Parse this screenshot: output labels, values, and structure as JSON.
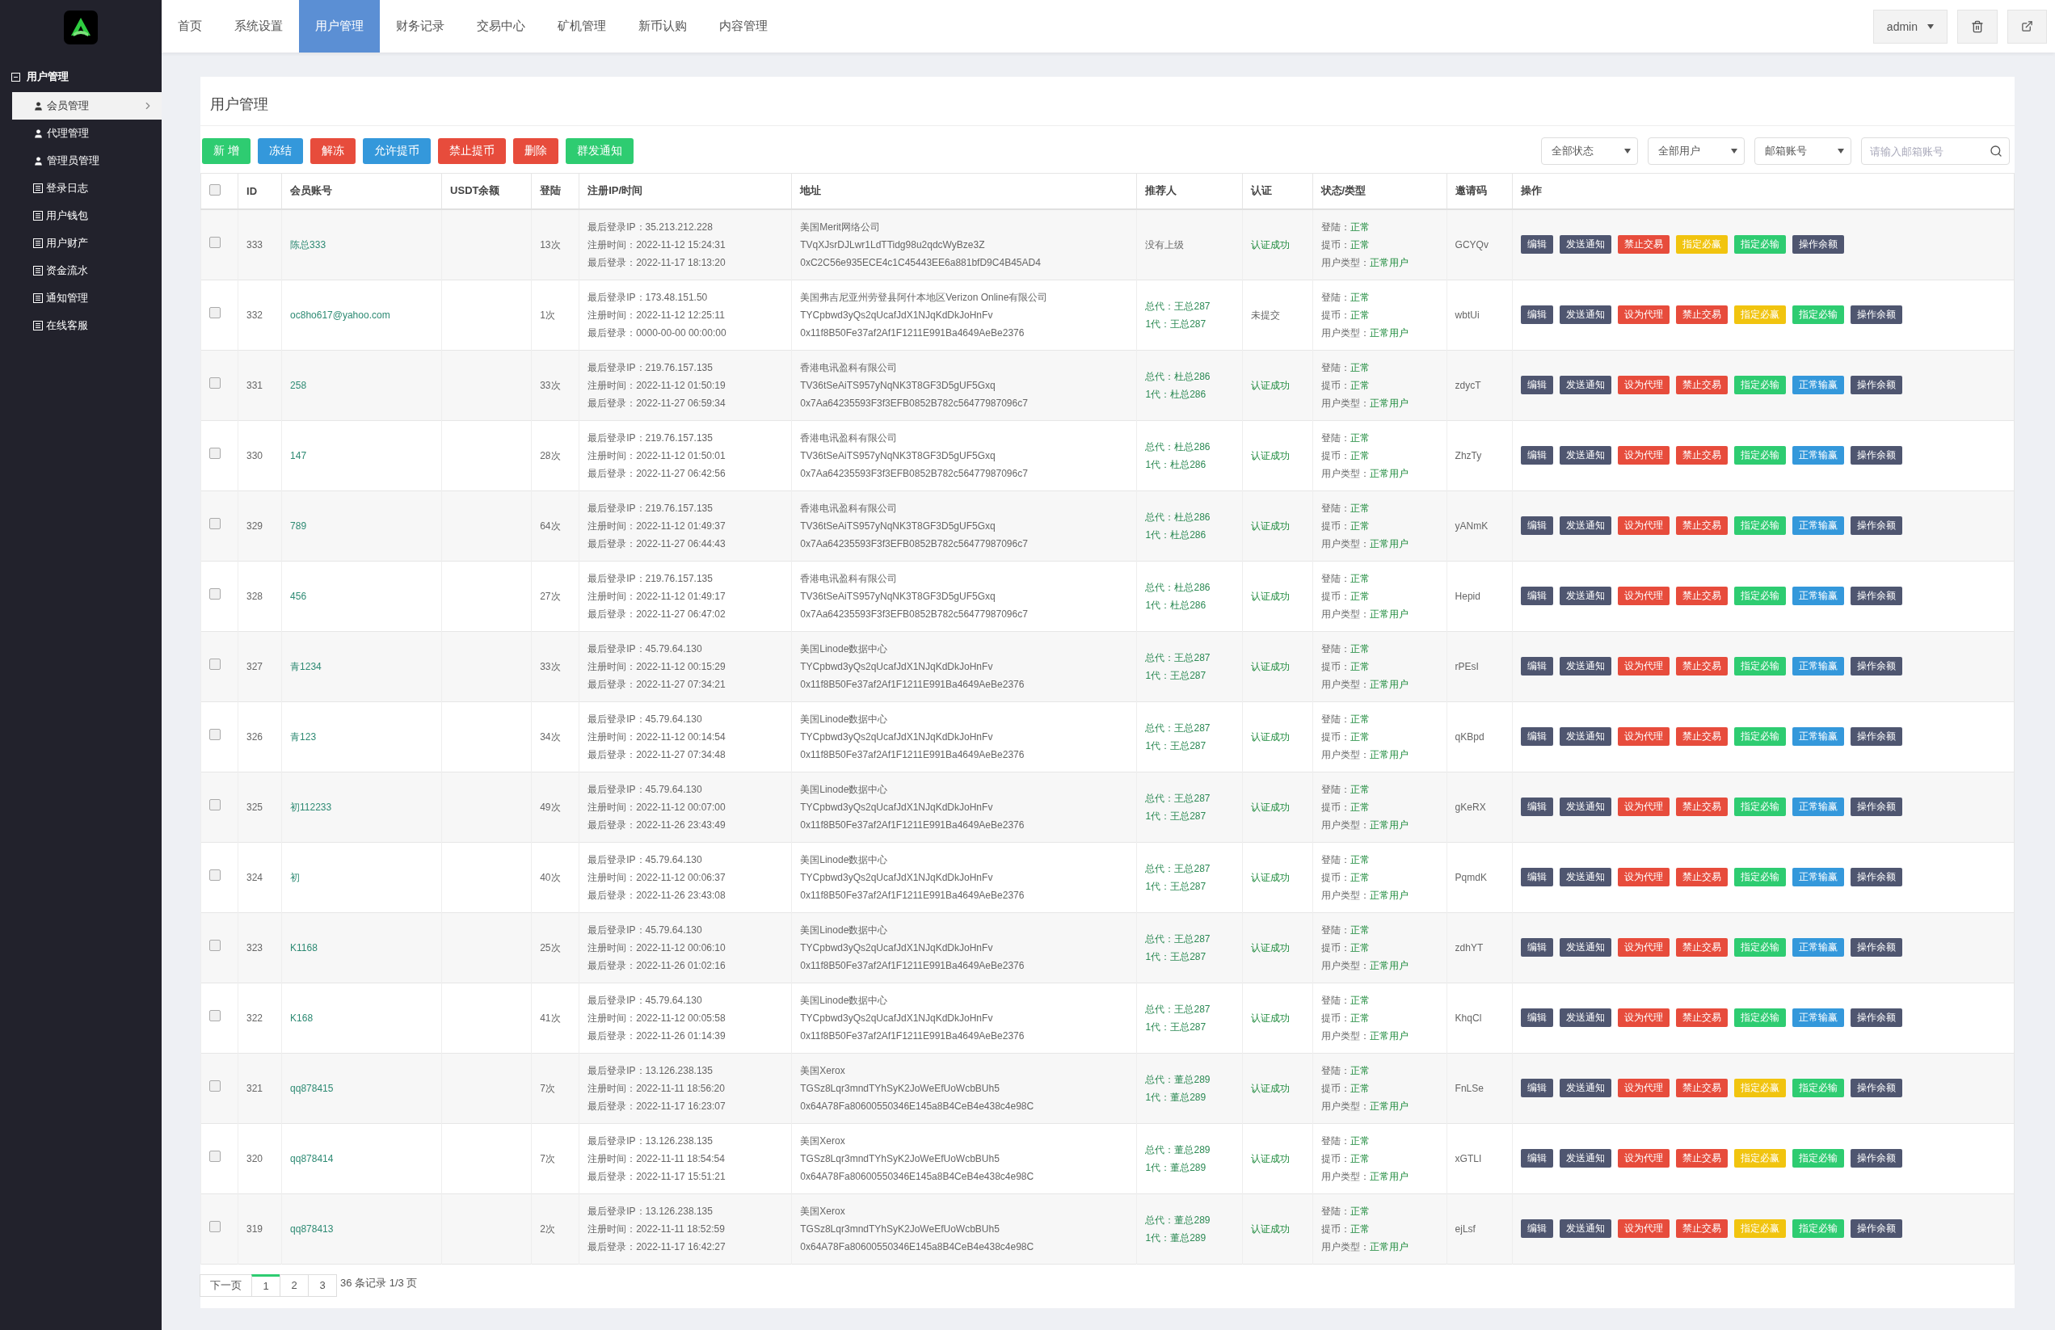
{
  "sidebar": {
    "section": "用户管理",
    "items": [
      {
        "label": "会员管理",
        "kind": "user",
        "selected": true
      },
      {
        "label": "代理管理",
        "kind": "user",
        "selected": false
      },
      {
        "label": "管理员管理",
        "kind": "user",
        "selected": false
      },
      {
        "label": "登录日志",
        "kind": "list",
        "selected": false
      },
      {
        "label": "用户钱包",
        "kind": "list",
        "selected": false
      },
      {
        "label": "用户财产",
        "kind": "list",
        "selected": false
      },
      {
        "label": "资金流水",
        "kind": "list",
        "selected": false
      },
      {
        "label": "通知管理",
        "kind": "list",
        "selected": false
      },
      {
        "label": "在线客服",
        "kind": "list",
        "selected": false
      }
    ]
  },
  "nav": {
    "tabs": [
      {
        "label": "首页",
        "selected": false
      },
      {
        "label": "系统设置",
        "selected": false
      },
      {
        "label": "用户管理",
        "selected": true
      },
      {
        "label": "财务记录",
        "selected": false
      },
      {
        "label": "交易中心",
        "selected": false
      },
      {
        "label": "矿机管理",
        "selected": false
      },
      {
        "label": "新币认购",
        "selected": false
      },
      {
        "label": "内容管理",
        "selected": false
      }
    ],
    "user": "admin"
  },
  "page_title": "用户管理",
  "toolbar": [
    {
      "label": "新 增",
      "kind": "green"
    },
    {
      "label": "冻结",
      "kind": "blue"
    },
    {
      "label": "解冻",
      "kind": "red"
    },
    {
      "label": "允许提币",
      "kind": "blue"
    },
    {
      "label": "禁止提币",
      "kind": "red"
    },
    {
      "label": "删除",
      "kind": "red"
    },
    {
      "label": "群发通知",
      "kind": "green"
    }
  ],
  "filters": {
    "selects": [
      "全部状态",
      "全部用户",
      "邮箱账号"
    ],
    "search_placeholder": "请输入邮箱账号"
  },
  "table": {
    "header_checked": false,
    "columns": [
      "ID",
      "会员账号",
      "USDT余额",
      "登陆",
      "注册IP/时间",
      "地址",
      "推荐人",
      "认证",
      "状态/类型",
      "邀请码",
      "操作"
    ],
    "rows": [
      {
        "checked": false,
        "id": "333",
        "account": "陈总333",
        "logins": "13次",
        "ip_time": [
          "最后登录IP：35.213.212.228",
          "注册时间：2022-11-12 15:24:31",
          "最后登录：2022-11-17 18:13:20"
        ],
        "address": [
          "美国Merit网络公司",
          "TVqXJsrDJLwr1LdTTidg98u2qdcWyBze3Z",
          "0xC2C56e935ECE4c1C45443EE6a881bfD9C4B45AD4"
        ],
        "referrer": {
          "kind": "none",
          "lines": [
            "没有上级"
          ]
        },
        "auth": {
          "text": "认证成功",
          "verified": true
        },
        "status": [
          {
            "label": "登陆：",
            "value": "正常"
          },
          {
            "label": "提币：",
            "value": "正常"
          },
          {
            "label": "用户类型：",
            "value": "正常用户"
          }
        ],
        "invite": "GCYQv",
        "actions": [
          {
            "label": "编辑",
            "kind": "dark"
          },
          {
            "label": "发送通知",
            "kind": "dark"
          },
          {
            "label": "禁止交易",
            "kind": "red"
          },
          {
            "label": "指定必赢",
            "kind": "yellow"
          },
          {
            "label": "指定必输",
            "kind": "green"
          },
          {
            "label": "操作余额",
            "kind": "dark"
          }
        ]
      },
      {
        "checked": false,
        "id": "332",
        "account": "oc8ho617@yahoo.com",
        "logins": "1次",
        "ip_time": [
          "最后登录IP：173.48.151.50",
          "注册时间：2022-11-12 12:25:11",
          "最后登录：0000-00-00 00:00:00"
        ],
        "address": [
          "美国弗吉尼亚州劳登县阿什本地区Verizon Online有限公司",
          "TYCpbwd3yQs2qUcafJdX1NJqKdDkJoHnFv",
          "0x11f8B50Fe37af2Af1F1211E991Ba4649AeBe2376"
        ],
        "referrer": {
          "kind": "chain",
          "lines": [
            "总代：王总287",
            "1代：王总287"
          ]
        },
        "auth": {
          "text": "未提交",
          "verified": false
        },
        "status": [
          {
            "label": "登陆：",
            "value": "正常"
          },
          {
            "label": "提币：",
            "value": "正常"
          },
          {
            "label": "用户类型：",
            "value": "正常用户"
          }
        ],
        "invite": "wbtUi",
        "actions": [
          {
            "label": "编辑",
            "kind": "dark"
          },
          {
            "label": "发送通知",
            "kind": "dark"
          },
          {
            "label": "设为代理",
            "kind": "red"
          },
          {
            "label": "禁止交易",
            "kind": "red"
          },
          {
            "label": "指定必赢",
            "kind": "yellow"
          },
          {
            "label": "指定必输",
            "kind": "green"
          },
          {
            "label": "操作余额",
            "kind": "dark"
          }
        ]
      },
      {
        "checked": false,
        "id": "331",
        "account": "258",
        "logins": "33次",
        "ip_time": [
          "最后登录IP：219.76.157.135",
          "注册时间：2022-11-12 01:50:19",
          "最后登录：2022-11-27 06:59:34"
        ],
        "address": [
          "香港电讯盈科有限公司",
          "TV36tSeAiTS957yNqNK3T8GF3D5gUF5Gxq",
          "0x7Aa64235593F3f3EFB0852B782c56477987096c7"
        ],
        "referrer": {
          "kind": "chain",
          "lines": [
            "总代：杜总286",
            "1代：杜总286"
          ]
        },
        "auth": {
          "text": "认证成功",
          "verified": true
        },
        "status": [
          {
            "label": "登陆：",
            "value": "正常"
          },
          {
            "label": "提币：",
            "value": "正常"
          },
          {
            "label": "用户类型：",
            "value": "正常用户"
          }
        ],
        "invite": "zdycT",
        "actions": [
          {
            "label": "编辑",
            "kind": "dark"
          },
          {
            "label": "发送通知",
            "kind": "dark"
          },
          {
            "label": "设为代理",
            "kind": "red"
          },
          {
            "label": "禁止交易",
            "kind": "red"
          },
          {
            "label": "指定必输",
            "kind": "green"
          },
          {
            "label": "正常输赢",
            "kind": "blue"
          },
          {
            "label": "操作余额",
            "kind": "dark"
          }
        ]
      },
      {
        "checked": false,
        "id": "330",
        "account": "147",
        "logins": "28次",
        "ip_time": [
          "最后登录IP：219.76.157.135",
          "注册时间：2022-11-12 01:50:01",
          "最后登录：2022-11-27 06:42:56"
        ],
        "address": [
          "香港电讯盈科有限公司",
          "TV36tSeAiTS957yNqNK3T8GF3D5gUF5Gxq",
          "0x7Aa64235593F3f3EFB0852B782c56477987096c7"
        ],
        "referrer": {
          "kind": "chain",
          "lines": [
            "总代：杜总286",
            "1代：杜总286"
          ]
        },
        "auth": {
          "text": "认证成功",
          "verified": true
        },
        "status": [
          {
            "label": "登陆：",
            "value": "正常"
          },
          {
            "label": "提币：",
            "value": "正常"
          },
          {
            "label": "用户类型：",
            "value": "正常用户"
          }
        ],
        "invite": "ZhzTy",
        "actions": [
          {
            "label": "编辑",
            "kind": "dark"
          },
          {
            "label": "发送通知",
            "kind": "dark"
          },
          {
            "label": "设为代理",
            "kind": "red"
          },
          {
            "label": "禁止交易",
            "kind": "red"
          },
          {
            "label": "指定必输",
            "kind": "green"
          },
          {
            "label": "正常输赢",
            "kind": "blue"
          },
          {
            "label": "操作余额",
            "kind": "dark"
          }
        ]
      },
      {
        "checked": false,
        "id": "329",
        "account": "789",
        "logins": "64次",
        "ip_time": [
          "最后登录IP：219.76.157.135",
          "注册时间：2022-11-12 01:49:37",
          "最后登录：2022-11-27 06:44:43"
        ],
        "address": [
          "香港电讯盈科有限公司",
          "TV36tSeAiTS957yNqNK3T8GF3D5gUF5Gxq",
          "0x7Aa64235593F3f3EFB0852B782c56477987096c7"
        ],
        "referrer": {
          "kind": "chain",
          "lines": [
            "总代：杜总286",
            "1代：杜总286"
          ]
        },
        "auth": {
          "text": "认证成功",
          "verified": true
        },
        "status": [
          {
            "label": "登陆：",
            "value": "正常"
          },
          {
            "label": "提币：",
            "value": "正常"
          },
          {
            "label": "用户类型：",
            "value": "正常用户"
          }
        ],
        "invite": "yANmK",
        "actions": [
          {
            "label": "编辑",
            "kind": "dark"
          },
          {
            "label": "发送通知",
            "kind": "dark"
          },
          {
            "label": "设为代理",
            "kind": "red"
          },
          {
            "label": "禁止交易",
            "kind": "red"
          },
          {
            "label": "指定必输",
            "kind": "green"
          },
          {
            "label": "正常输赢",
            "kind": "blue"
          },
          {
            "label": "操作余额",
            "kind": "dark"
          }
        ]
      },
      {
        "checked": false,
        "id": "328",
        "account": "456",
        "logins": "27次",
        "ip_time": [
          "最后登录IP：219.76.157.135",
          "注册时间：2022-11-12 01:49:17",
          "最后登录：2022-11-27 06:47:02"
        ],
        "address": [
          "香港电讯盈科有限公司",
          "TV36tSeAiTS957yNqNK3T8GF3D5gUF5Gxq",
          "0x7Aa64235593F3f3EFB0852B782c56477987096c7"
        ],
        "referrer": {
          "kind": "chain",
          "lines": [
            "总代：杜总286",
            "1代：杜总286"
          ]
        },
        "auth": {
          "text": "认证成功",
          "verified": true
        },
        "status": [
          {
            "label": "登陆：",
            "value": "正常"
          },
          {
            "label": "提币：",
            "value": "正常"
          },
          {
            "label": "用户类型：",
            "value": "正常用户"
          }
        ],
        "invite": "Hepid",
        "actions": [
          {
            "label": "编辑",
            "kind": "dark"
          },
          {
            "label": "发送通知",
            "kind": "dark"
          },
          {
            "label": "设为代理",
            "kind": "red"
          },
          {
            "label": "禁止交易",
            "kind": "red"
          },
          {
            "label": "指定必输",
            "kind": "green"
          },
          {
            "label": "正常输赢",
            "kind": "blue"
          },
          {
            "label": "操作余额",
            "kind": "dark"
          }
        ]
      },
      {
        "checked": false,
        "id": "327",
        "account": "青1234",
        "logins": "33次",
        "ip_time": [
          "最后登录IP：45.79.64.130",
          "注册时间：2022-11-12 00:15:29",
          "最后登录：2022-11-27 07:34:21"
        ],
        "address": [
          "美国Linode数据中心",
          "TYCpbwd3yQs2qUcafJdX1NJqKdDkJoHnFv",
          "0x11f8B50Fe37af2Af1F1211E991Ba4649AeBe2376"
        ],
        "referrer": {
          "kind": "chain",
          "lines": [
            "总代：王总287",
            "1代：王总287"
          ]
        },
        "auth": {
          "text": "认证成功",
          "verified": true
        },
        "status": [
          {
            "label": "登陆：",
            "value": "正常"
          },
          {
            "label": "提币：",
            "value": "正常"
          },
          {
            "label": "用户类型：",
            "value": "正常用户"
          }
        ],
        "invite": "rPEsI",
        "actions": [
          {
            "label": "编辑",
            "kind": "dark"
          },
          {
            "label": "发送通知",
            "kind": "dark"
          },
          {
            "label": "设为代理",
            "kind": "red"
          },
          {
            "label": "禁止交易",
            "kind": "red"
          },
          {
            "label": "指定必输",
            "kind": "green"
          },
          {
            "label": "正常输赢",
            "kind": "blue"
          },
          {
            "label": "操作余额",
            "kind": "dark"
          }
        ]
      },
      {
        "checked": false,
        "id": "326",
        "account": "青123",
        "logins": "34次",
        "ip_time": [
          "最后登录IP：45.79.64.130",
          "注册时间：2022-11-12 00:14:54",
          "最后登录：2022-11-27 07:34:48"
        ],
        "address": [
          "美国Linode数据中心",
          "TYCpbwd3yQs2qUcafJdX1NJqKdDkJoHnFv",
          "0x11f8B50Fe37af2Af1F1211E991Ba4649AeBe2376"
        ],
        "referrer": {
          "kind": "chain",
          "lines": [
            "总代：王总287",
            "1代：王总287"
          ]
        },
        "auth": {
          "text": "认证成功",
          "verified": true
        },
        "status": [
          {
            "label": "登陆：",
            "value": "正常"
          },
          {
            "label": "提币：",
            "value": "正常"
          },
          {
            "label": "用户类型：",
            "value": "正常用户"
          }
        ],
        "invite": "qKBpd",
        "actions": [
          {
            "label": "编辑",
            "kind": "dark"
          },
          {
            "label": "发送通知",
            "kind": "dark"
          },
          {
            "label": "设为代理",
            "kind": "red"
          },
          {
            "label": "禁止交易",
            "kind": "red"
          },
          {
            "label": "指定必输",
            "kind": "green"
          },
          {
            "label": "正常输赢",
            "kind": "blue"
          },
          {
            "label": "操作余额",
            "kind": "dark"
          }
        ]
      },
      {
        "checked": false,
        "id": "325",
        "account": "初112233",
        "logins": "49次",
        "ip_time": [
          "最后登录IP：45.79.64.130",
          "注册时间：2022-11-12 00:07:00",
          "最后登录：2022-11-26 23:43:49"
        ],
        "address": [
          "美国Linode数据中心",
          "TYCpbwd3yQs2qUcafJdX1NJqKdDkJoHnFv",
          "0x11f8B50Fe37af2Af1F1211E991Ba4649AeBe2376"
        ],
        "referrer": {
          "kind": "chain",
          "lines": [
            "总代：王总287",
            "1代：王总287"
          ]
        },
        "auth": {
          "text": "认证成功",
          "verified": true
        },
        "status": [
          {
            "label": "登陆：",
            "value": "正常"
          },
          {
            "label": "提币：",
            "value": "正常"
          },
          {
            "label": "用户类型：",
            "value": "正常用户"
          }
        ],
        "invite": "gKeRX",
        "actions": [
          {
            "label": "编辑",
            "kind": "dark"
          },
          {
            "label": "发送通知",
            "kind": "dark"
          },
          {
            "label": "设为代理",
            "kind": "red"
          },
          {
            "label": "禁止交易",
            "kind": "red"
          },
          {
            "label": "指定必输",
            "kind": "green"
          },
          {
            "label": "正常输赢",
            "kind": "blue"
          },
          {
            "label": "操作余额",
            "kind": "dark"
          }
        ]
      },
      {
        "checked": false,
        "id": "324",
        "account": "初",
        "logins": "40次",
        "ip_time": [
          "最后登录IP：45.79.64.130",
          "注册时间：2022-11-12 00:06:37",
          "最后登录：2022-11-26 23:43:08"
        ],
        "address": [
          "美国Linode数据中心",
          "TYCpbwd3yQs2qUcafJdX1NJqKdDkJoHnFv",
          "0x11f8B50Fe37af2Af1F1211E991Ba4649AeBe2376"
        ],
        "referrer": {
          "kind": "chain",
          "lines": [
            "总代：王总287",
            "1代：王总287"
          ]
        },
        "auth": {
          "text": "认证成功",
          "verified": true
        },
        "status": [
          {
            "label": "登陆：",
            "value": "正常"
          },
          {
            "label": "提币：",
            "value": "正常"
          },
          {
            "label": "用户类型：",
            "value": "正常用户"
          }
        ],
        "invite": "PqmdK",
        "actions": [
          {
            "label": "编辑",
            "kind": "dark"
          },
          {
            "label": "发送通知",
            "kind": "dark"
          },
          {
            "label": "设为代理",
            "kind": "red"
          },
          {
            "label": "禁止交易",
            "kind": "red"
          },
          {
            "label": "指定必输",
            "kind": "green"
          },
          {
            "label": "正常输赢",
            "kind": "blue"
          },
          {
            "label": "操作余额",
            "kind": "dark"
          }
        ]
      },
      {
        "checked": false,
        "id": "323",
        "account": "K1168",
        "logins": "25次",
        "ip_time": [
          "最后登录IP：45.79.64.130",
          "注册时间：2022-11-12 00:06:10",
          "最后登录：2022-11-26 01:02:16"
        ],
        "address": [
          "美国Linode数据中心",
          "TYCpbwd3yQs2qUcafJdX1NJqKdDkJoHnFv",
          "0x11f8B50Fe37af2Af1F1211E991Ba4649AeBe2376"
        ],
        "referrer": {
          "kind": "chain",
          "lines": [
            "总代：王总287",
            "1代：王总287"
          ]
        },
        "auth": {
          "text": "认证成功",
          "verified": true
        },
        "status": [
          {
            "label": "登陆：",
            "value": "正常"
          },
          {
            "label": "提币：",
            "value": "正常"
          },
          {
            "label": "用户类型：",
            "value": "正常用户"
          }
        ],
        "invite": "zdhYT",
        "actions": [
          {
            "label": "编辑",
            "kind": "dark"
          },
          {
            "label": "发送通知",
            "kind": "dark"
          },
          {
            "label": "设为代理",
            "kind": "red"
          },
          {
            "label": "禁止交易",
            "kind": "red"
          },
          {
            "label": "指定必输",
            "kind": "green"
          },
          {
            "label": "正常输赢",
            "kind": "blue"
          },
          {
            "label": "操作余额",
            "kind": "dark"
          }
        ]
      },
      {
        "checked": false,
        "id": "322",
        "account": "K168",
        "logins": "41次",
        "ip_time": [
          "最后登录IP：45.79.64.130",
          "注册时间：2022-11-12 00:05:58",
          "最后登录：2022-11-26 01:14:39"
        ],
        "address": [
          "美国Linode数据中心",
          "TYCpbwd3yQs2qUcafJdX1NJqKdDkJoHnFv",
          "0x11f8B50Fe37af2Af1F1211E991Ba4649AeBe2376"
        ],
        "referrer": {
          "kind": "chain",
          "lines": [
            "总代：王总287",
            "1代：王总287"
          ]
        },
        "auth": {
          "text": "认证成功",
          "verified": true
        },
        "status": [
          {
            "label": "登陆：",
            "value": "正常"
          },
          {
            "label": "提币：",
            "value": "正常"
          },
          {
            "label": "用户类型：",
            "value": "正常用户"
          }
        ],
        "invite": "KhqCl",
        "actions": [
          {
            "label": "编辑",
            "kind": "dark"
          },
          {
            "label": "发送通知",
            "kind": "dark"
          },
          {
            "label": "设为代理",
            "kind": "red"
          },
          {
            "label": "禁止交易",
            "kind": "red"
          },
          {
            "label": "指定必输",
            "kind": "green"
          },
          {
            "label": "正常输赢",
            "kind": "blue"
          },
          {
            "label": "操作余额",
            "kind": "dark"
          }
        ]
      },
      {
        "checked": false,
        "id": "321",
        "account": "qq878415",
        "logins": "7次",
        "ip_time": [
          "最后登录IP：13.126.238.135",
          "注册时间：2022-11-11 18:56:20",
          "最后登录：2022-11-17 16:23:07"
        ],
        "address": [
          "美国Xerox",
          "TGSz8Lqr3mndTYhSyK2JoWeEfUoWcbBUh5",
          "0x64A78Fa80600550346E145a8B4CeB4e438c4e98C"
        ],
        "referrer": {
          "kind": "chain",
          "lines": [
            "总代：董总289",
            "1代：董总289"
          ]
        },
        "auth": {
          "text": "认证成功",
          "verified": true
        },
        "status": [
          {
            "label": "登陆：",
            "value": "正常"
          },
          {
            "label": "提币：",
            "value": "正常"
          },
          {
            "label": "用户类型：",
            "value": "正常用户"
          }
        ],
        "invite": "FnLSe",
        "actions": [
          {
            "label": "编辑",
            "kind": "dark"
          },
          {
            "label": "发送通知",
            "kind": "dark"
          },
          {
            "label": "设为代理",
            "kind": "red"
          },
          {
            "label": "禁止交易",
            "kind": "red"
          },
          {
            "label": "指定必赢",
            "kind": "yellow"
          },
          {
            "label": "指定必输",
            "kind": "green"
          },
          {
            "label": "操作余额",
            "kind": "dark"
          }
        ]
      },
      {
        "checked": false,
        "id": "320",
        "account": "qq878414",
        "logins": "7次",
        "ip_time": [
          "最后登录IP：13.126.238.135",
          "注册时间：2022-11-11 18:54:54",
          "最后登录：2022-11-17 15:51:21"
        ],
        "address": [
          "美国Xerox",
          "TGSz8Lqr3mndTYhSyK2JoWeEfUoWcbBUh5",
          "0x64A78Fa80600550346E145a8B4CeB4e438c4e98C"
        ],
        "referrer": {
          "kind": "chain",
          "lines": [
            "总代：董总289",
            "1代：董总289"
          ]
        },
        "auth": {
          "text": "认证成功",
          "verified": true
        },
        "status": [
          {
            "label": "登陆：",
            "value": "正常"
          },
          {
            "label": "提币：",
            "value": "正常"
          },
          {
            "label": "用户类型：",
            "value": "正常用户"
          }
        ],
        "invite": "xGTLI",
        "actions": [
          {
            "label": "编辑",
            "kind": "dark"
          },
          {
            "label": "发送通知",
            "kind": "dark"
          },
          {
            "label": "设为代理",
            "kind": "red"
          },
          {
            "label": "禁止交易",
            "kind": "red"
          },
          {
            "label": "指定必赢",
            "kind": "yellow"
          },
          {
            "label": "指定必输",
            "kind": "green"
          },
          {
            "label": "操作余额",
            "kind": "dark"
          }
        ]
      },
      {
        "checked": false,
        "id": "319",
        "account": "qq878413",
        "logins": "2次",
        "ip_time": [
          "最后登录IP：13.126.238.135",
          "注册时间：2022-11-11 18:52:59",
          "最后登录：2022-11-17 16:42:27"
        ],
        "address": [
          "美国Xerox",
          "TGSz8Lqr3mndTYhSyK2JoWeEfUoWcbBUh5",
          "0x64A78Fa80600550346E145a8B4CeB4e438c4e98C"
        ],
        "referrer": {
          "kind": "chain",
          "lines": [
            "总代：董总289",
            "1代：董总289"
          ]
        },
        "auth": {
          "text": "认证成功",
          "verified": true
        },
        "status": [
          {
            "label": "登陆：",
            "value": "正常"
          },
          {
            "label": "提币：",
            "value": "正常"
          },
          {
            "label": "用户类型：",
            "value": "正常用户"
          }
        ],
        "invite": "ejLsf",
        "actions": [
          {
            "label": "编辑",
            "kind": "dark"
          },
          {
            "label": "发送通知",
            "kind": "dark"
          },
          {
            "label": "设为代理",
            "kind": "red"
          },
          {
            "label": "禁止交易",
            "kind": "red"
          },
          {
            "label": "指定必赢",
            "kind": "yellow"
          },
          {
            "label": "指定必输",
            "kind": "green"
          },
          {
            "label": "操作余额",
            "kind": "dark"
          }
        ]
      }
    ]
  },
  "pagination": {
    "next": "下一页",
    "pages": [
      {
        "label": "1",
        "selected": true
      },
      {
        "label": "2",
        "selected": false
      },
      {
        "label": "3",
        "selected": false
      }
    ],
    "info": "36 条记录 1/3 页"
  }
}
